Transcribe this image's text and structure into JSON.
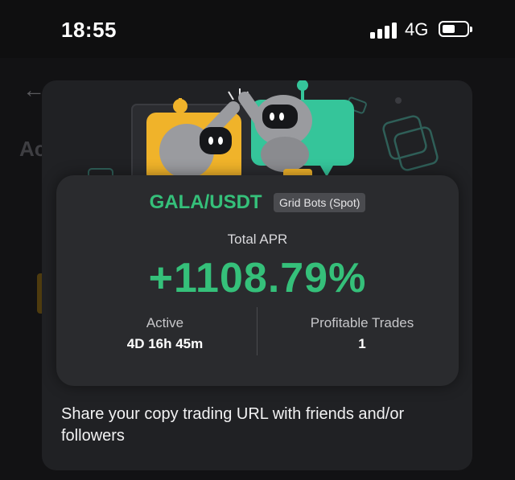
{
  "status_bar": {
    "time": "18:55",
    "network": "4G",
    "signal_icon": "signal-bars-icon",
    "battery_icon": "battery-icon",
    "battery_level": 0.5
  },
  "background_page": {
    "back_icon": "arrow-left-icon",
    "title_fragment": "Ac"
  },
  "share_card": {
    "pair": "GALA/USDT",
    "bot_type": "Grid Bots (Spot)",
    "apr_label": "Total APR",
    "apr_value": "+1108.79%",
    "stats": [
      {
        "label": "Active",
        "value": "4D 16h 45m"
      },
      {
        "label": "Profitable Trades",
        "value": "1"
      }
    ]
  },
  "share_text": "Share your copy trading URL with friends and/or followers",
  "colors": {
    "accent_green": "#35c07a",
    "robot_yellow": "#f0b32a",
    "robot_teal": "#35c59a",
    "modal_bg": "#202124",
    "card_bg": "#2a2b2e"
  }
}
